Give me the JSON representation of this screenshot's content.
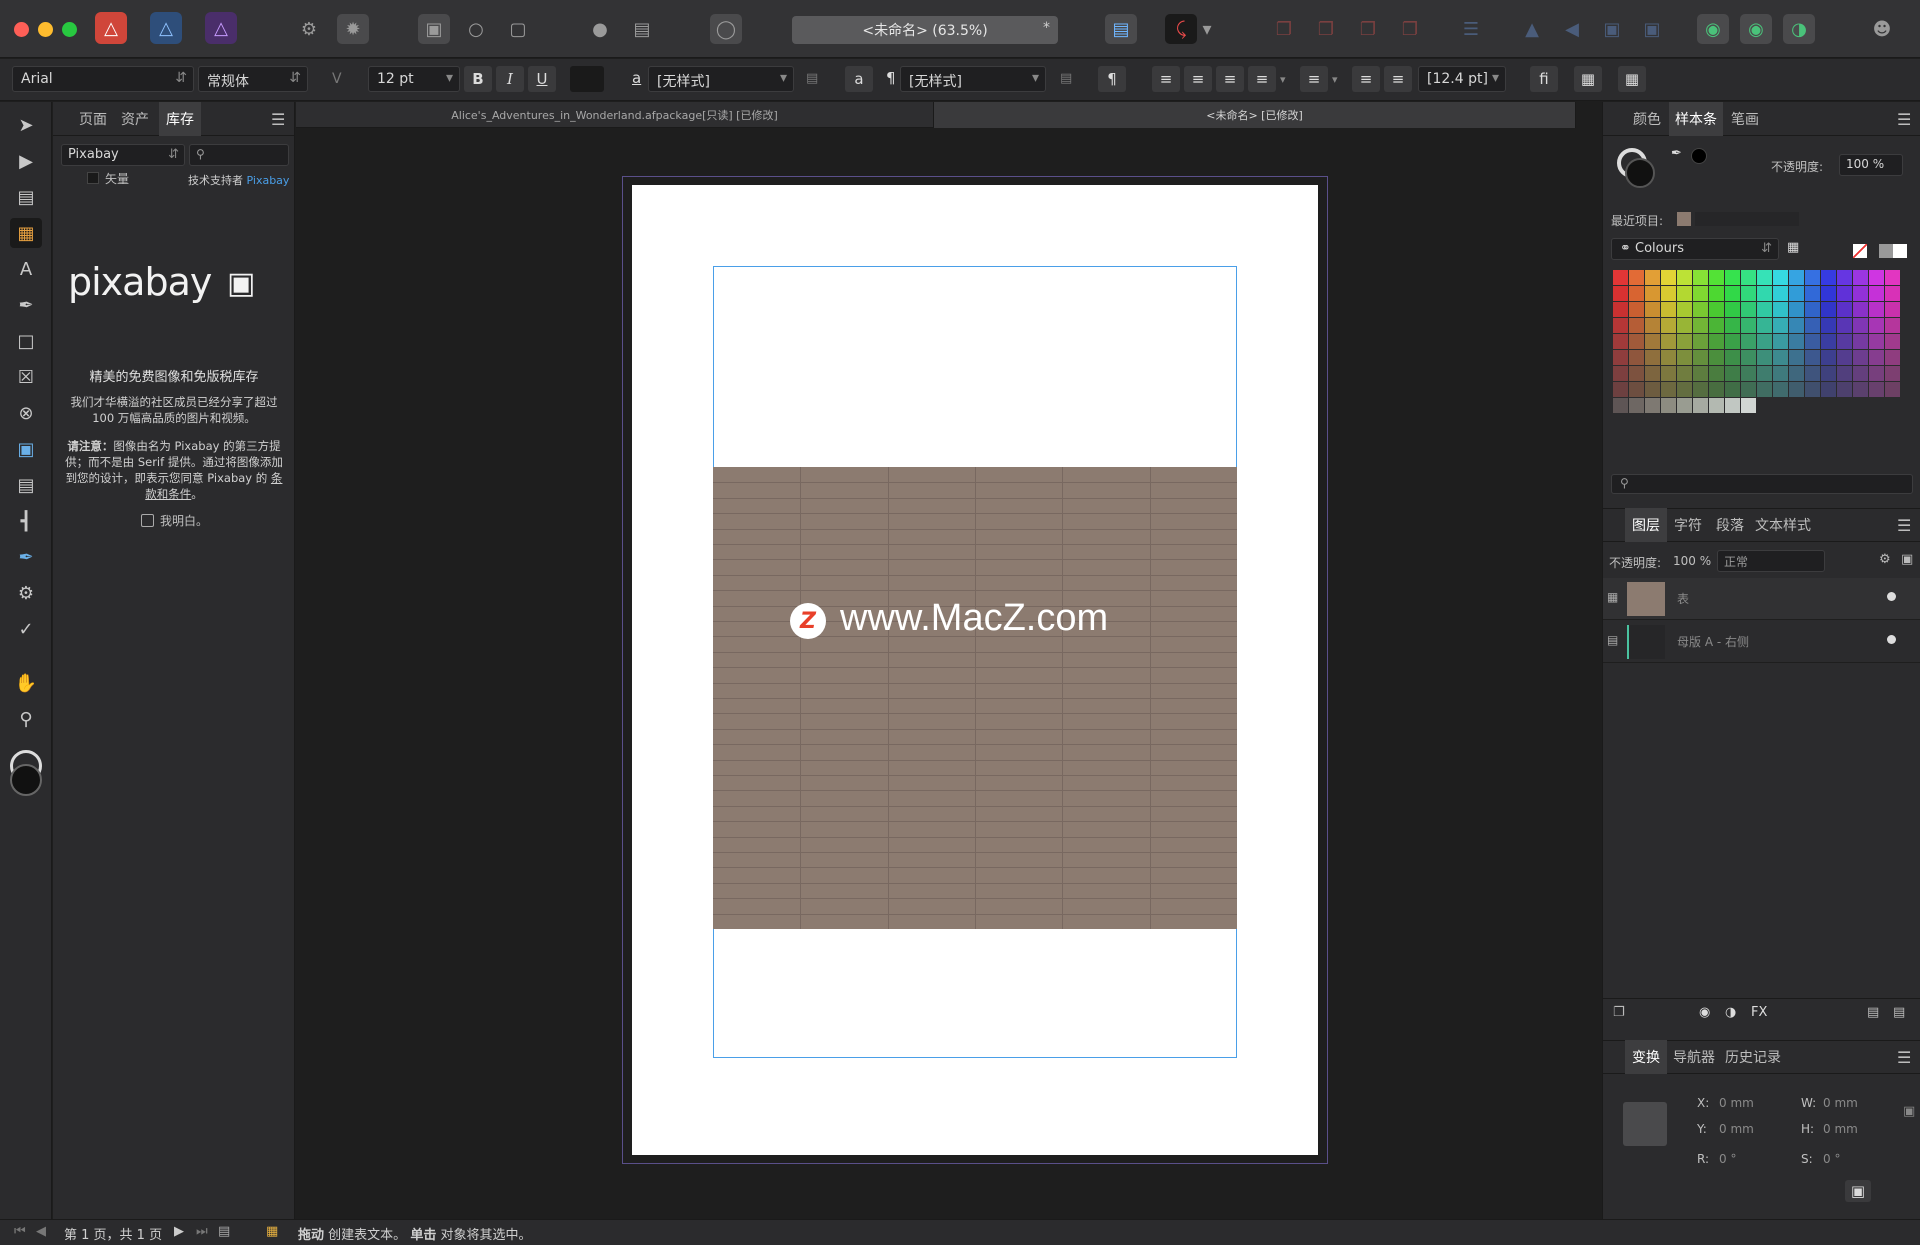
{
  "titlebar": {
    "doc_title": "<未命名> (63.5%)",
    "modified_star": "*"
  },
  "context": {
    "font_family": "Arial",
    "font_style": "常规体",
    "font_size": "12 pt",
    "bold": "B",
    "italic": "I",
    "underline": "U",
    "char_style_prefix": "a",
    "char_style": "[无样式]",
    "para_glyph": "¶",
    "para_style": "[无样式]",
    "spacing": "[12.4 pt]",
    "ligature": "fi"
  },
  "left_panel": {
    "tabs": [
      "页面",
      "资产",
      "库存"
    ],
    "source": "Pixabay",
    "vector_label": "矢量",
    "powered_by": "技术支持者",
    "powered_link": "Pixabay",
    "logo_text": "pixabay",
    "heading": "精美的免费图像和免版税库存",
    "desc": "我们才华横溢的社区成员已经分享了超过 100 万幅高品质的图片和视频。",
    "note_label": "请注意：",
    "note_text": "图像由名为 Pixabay 的第三方提供；而不是由 Serif 提供。通过将图像添加到您的设计，即表示您同意 Pixabay 的",
    "note_link": "条款和条件",
    "note_end": "。",
    "agree_label": "我明白。"
  },
  "doc_tabs": [
    "Alice's_Adventures_in_Wonderland.afpackage[只读] [已修改]",
    "<未命名> [已修改]"
  ],
  "watermark": "www.MacZ.com",
  "right_panel": {
    "swatch_tabs": [
      "颜色",
      "样本条",
      "笔画"
    ],
    "opacity_label": "不透明度:",
    "opacity_value": "100 %",
    "recent_label": "最近项目:",
    "palette_name": "Colours",
    "layers_tabs": [
      "图层",
      "字符",
      "段落",
      "文本样式"
    ],
    "layer_opacity_label": "不透明度:",
    "layer_opacity_value": "100 %",
    "blend_mode": "正常",
    "layers": [
      {
        "name": "表"
      },
      {
        "name": "母版 A - 右侧"
      }
    ],
    "transform_tabs": [
      "变换",
      "导航器",
      "历史记录"
    ],
    "x_label": "X:",
    "x_value": "0 mm",
    "y_label": "Y:",
    "y_value": "0 mm",
    "w_label": "W:",
    "w_value": "0 mm",
    "h_label": "H:",
    "h_value": "0 mm",
    "r_label": "R:",
    "r_value": "0 °",
    "s_label": "S:",
    "s_value": "0 °"
  },
  "status": {
    "page_info": "第 1 页，共 1 页",
    "drag_bold": "拖动",
    "drag_text": "创建表文本。",
    "click_bold": "单击",
    "click_text": "对象将其选中。"
  },
  "colors": {
    "table_fill": "#8c7b70",
    "accent_blue": "#4a9fe8",
    "panel_bg": "#2b2b2d"
  }
}
